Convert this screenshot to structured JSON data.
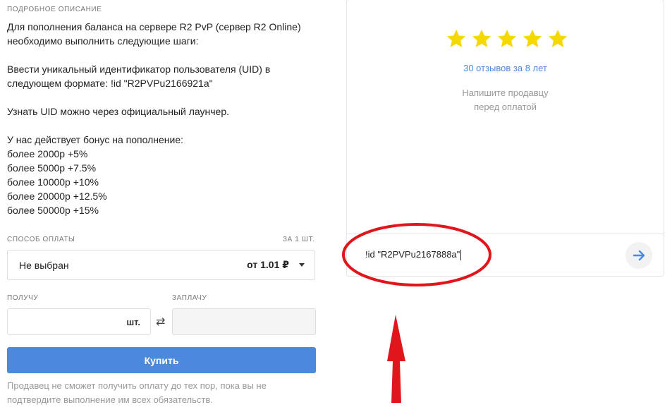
{
  "description": {
    "label": "ПОДРОБНОЕ ОПИСАНИЕ",
    "line1": "Для пополнения баланса на сервере R2 PvP (сервер R2 Online)",
    "line2": "необходимо выполнить следующие шаги:",
    "line3": "Ввести уникальный идентификатор пользователя (UID) в",
    "line4": "следующем формате: !id \"R2PVPu2166921a\"",
    "line5": "Узнать UID можно через официальный лаунчер.",
    "bonus_title": "У нас действует бонус на пополнение:",
    "bonuses": [
      "более 2000р +5%",
      "более 5000р +7.5%",
      "более 10000р +10%",
      "более 20000р +12.5%",
      "более 50000р +15%"
    ]
  },
  "payment": {
    "label": "СПОСОБ ОПЛАТЫ",
    "per_unit_label": "ЗА 1 ШТ.",
    "selected": "Не выбран",
    "price": "от 1.01 ₽"
  },
  "quantity": {
    "receive_label": "ПОЛУЧУ",
    "pay_label": "ЗАПЛАЧУ",
    "unit": "шт."
  },
  "buy_label": "Купить",
  "note": "Продавец не сможет получить оплату до тех пор, пока вы не подтвердите выполнение им всех обязательств.",
  "seller": {
    "rating": 5,
    "star_color": "#f5d800",
    "reviews": "30 отзывов за 8 лет",
    "hint_line1": "Напишите продавцу",
    "hint_line2": "перед оплатой"
  },
  "chat": {
    "input_text": "!id \"R2PVPu2167888a\""
  },
  "colors": {
    "accent": "#4a89dc",
    "annotation": "#e0161c"
  }
}
